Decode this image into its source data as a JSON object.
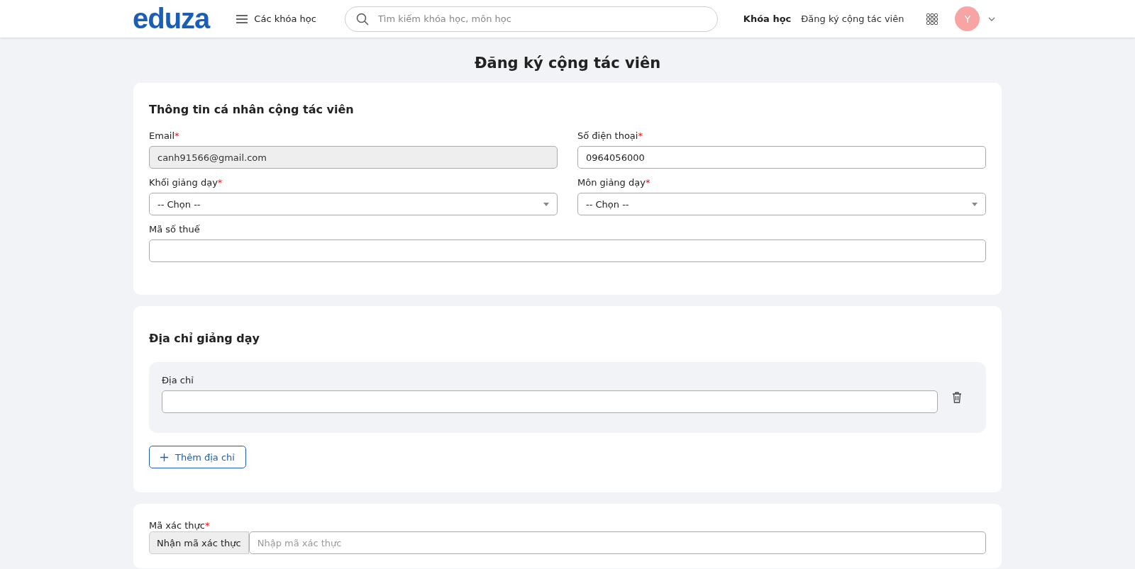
{
  "header": {
    "logo": "eduza",
    "menu_label": "Các khóa học",
    "search": {
      "placeholder": "Tìm kiếm khóa học, môn học"
    },
    "nav": [
      {
        "label": "Khóa học",
        "selected": true
      },
      {
        "label": "Đăng ký cộng tác viên",
        "selected": false
      }
    ],
    "avatar": "Y"
  },
  "page_title": "Đăng ký cộng tác viên",
  "personal": {
    "title": "Thông tin cá nhân cộng tác viên",
    "rows": [
      [
        {
          "label": "Email",
          "required_mark": "*",
          "kind": "input",
          "disabled": true,
          "value": "canh91566@gmail.com"
        },
        {
          "label": "Số điện thoại",
          "required_mark": "*",
          "kind": "input",
          "disabled": false,
          "value": "0964056000"
        }
      ],
      [
        {
          "label": "Khối giảng dạy",
          "required_mark": "*",
          "kind": "select",
          "disabled": false,
          "value": "-- Chọn --"
        },
        {
          "label": "Môn giảng dạy",
          "required_mark": "*",
          "kind": "select",
          "disabled": false,
          "value": "-- Chọn --"
        }
      ],
      [
        {
          "label": "Mã số thuế",
          "kind": "input",
          "disabled": false
        }
      ]
    ]
  },
  "address": {
    "title": "Địa chỉ giảng dạy",
    "items": [
      {
        "label": "Địa chỉ"
      }
    ],
    "add_button": "Thêm địa chỉ"
  },
  "verification": {
    "label": "Mã xác thực",
    "required_mark": "*",
    "button": "Nhận mã xác thực",
    "placeholder": "Nhập mã xác thực"
  }
}
